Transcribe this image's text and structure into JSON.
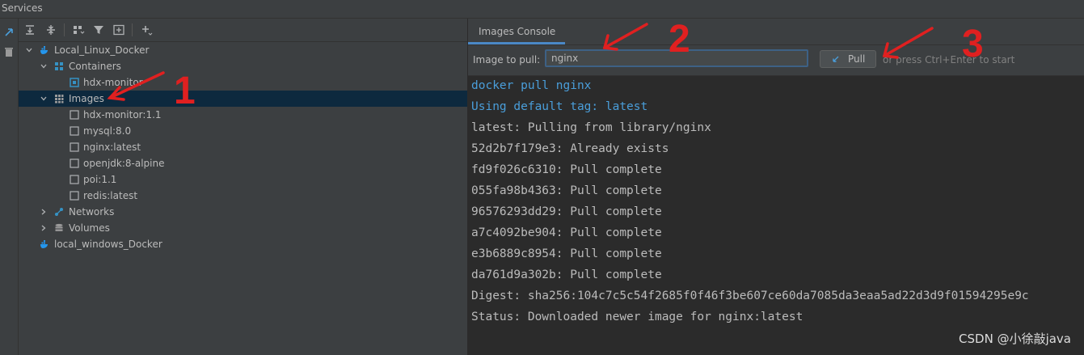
{
  "window": {
    "title": "Services"
  },
  "tree": {
    "nodes": [
      {
        "label": "Local_Linux_Docker"
      },
      {
        "label": "Containers"
      },
      {
        "label": "hdx-monitor"
      },
      {
        "label": "Images"
      },
      {
        "label": "hdx-monitor:1.1"
      },
      {
        "label": "mysql:8.0"
      },
      {
        "label": "nginx:latest"
      },
      {
        "label": "openjdk:8-alpine"
      },
      {
        "label": "poi:1.1"
      },
      {
        "label": "redis:latest"
      },
      {
        "label": "Networks"
      },
      {
        "label": "Volumes"
      },
      {
        "label": "local_windows_Docker"
      }
    ]
  },
  "console_tab": {
    "label": "Images Console"
  },
  "pull": {
    "label": "Image to pull:",
    "value": "nginx",
    "button_label": "Pull",
    "hint": "or press Ctrl+Enter to start"
  },
  "console": {
    "lines": [
      "docker pull nginx",
      "Using default tag: latest",
      "latest: Pulling from library/nginx",
      "52d2b7f179e3: Already exists",
      "fd9f026c6310: Pull complete",
      "055fa98b4363: Pull complete",
      "96576293dd29: Pull complete",
      "a7c4092be904: Pull complete",
      "e3b6889c8954: Pull complete",
      "da761d9a302b: Pull complete",
      "Digest: sha256:104c7c5c54f2685f0f46f3be607ce60da7085da3eaa5ad22d3d9f01594295e9c",
      "Status: Downloaded newer image for nginx:latest"
    ]
  },
  "annotations": [
    "1",
    "2",
    "3"
  ],
  "watermark": "CSDN @小徐敲java",
  "colors": {
    "arrow": "#e02020",
    "selection": "#0d293e",
    "command_text": "#4a9eda",
    "docker_blue": "#2496ed"
  },
  "icons": [
    "expand-all-icon",
    "collapse-all-icon",
    "group-icon",
    "filter-icon",
    "new-tab-icon",
    "add-icon",
    "docker-icon",
    "grid-icon",
    "container-icon",
    "image-icon",
    "network-icon",
    "volume-icon",
    "trash-icon",
    "pull-icon"
  ]
}
